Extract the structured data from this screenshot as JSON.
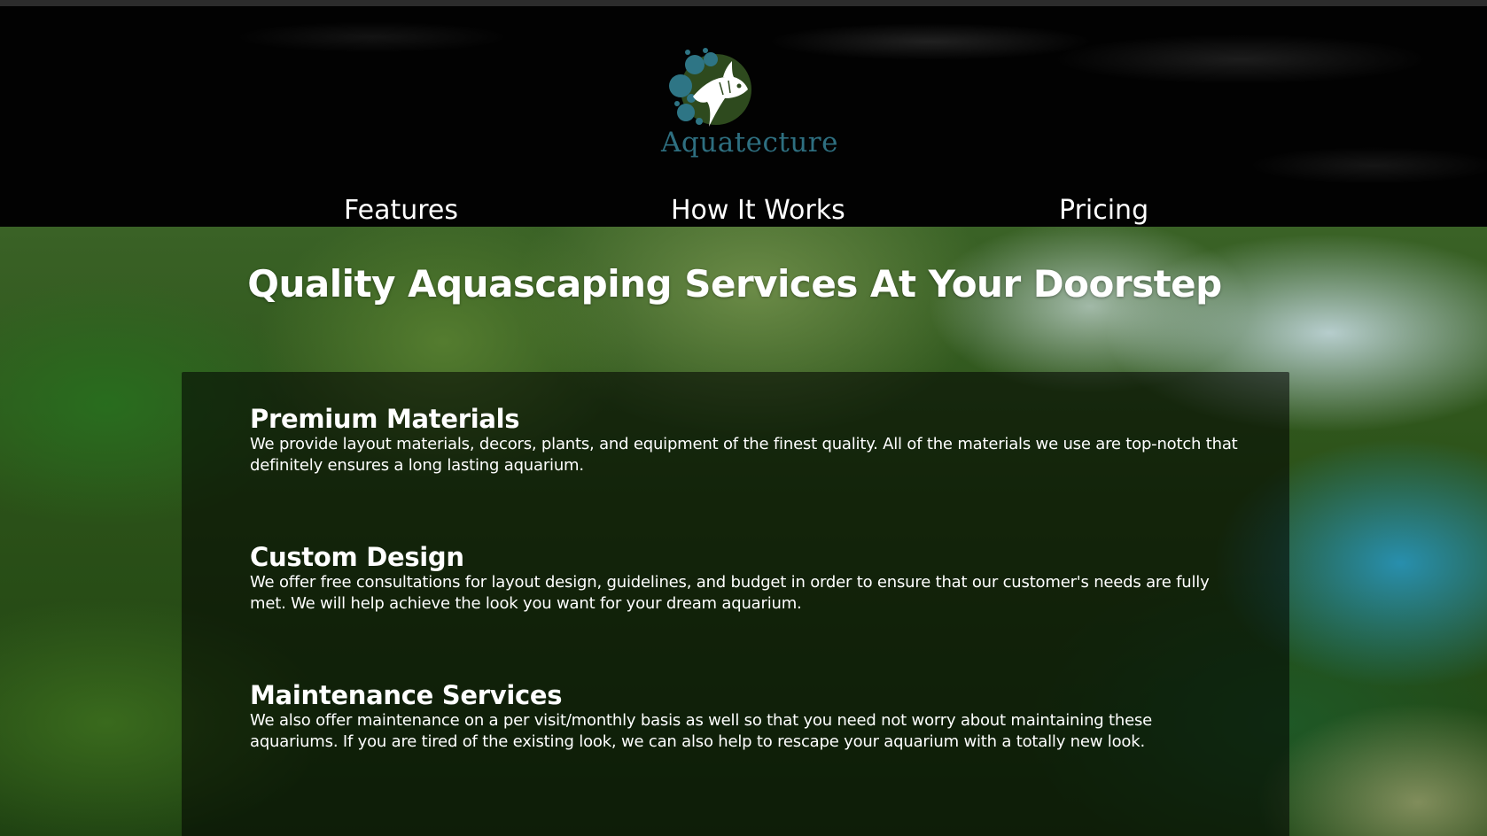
{
  "brand": {
    "name": "Aquatecture",
    "logo_icon": "angelfish-icon",
    "colors": {
      "logo_text": "#2e6f80",
      "logo_bubble": "#2e7585",
      "logo_circle": "#2e4a1e"
    }
  },
  "nav": {
    "items": [
      {
        "label": "Features"
      },
      {
        "label": "How It Works"
      },
      {
        "label": "Pricing"
      }
    ]
  },
  "hero": {
    "title": "Quality Aquascaping Services At Your Doorstep"
  },
  "features": [
    {
      "title": "Premium Materials",
      "description": "We provide layout materials, decors, plants, and equipment of the finest quality. All of the materials we use are top-notch that definitely ensures a long lasting aquarium."
    },
    {
      "title": "Custom Design",
      "description": "We offer free consultations for layout design, guidelines, and budget in order to ensure that our customer's needs are fully met. We will help achieve the look you want for your dream aquarium."
    },
    {
      "title": "Maintenance Services",
      "description": "We also offer maintenance on a per visit/monthly basis as well so that you need not worry about maintaining these aquariums. If you are tired of the existing look, we can also help to rescape your aquarium with a totally new look."
    }
  ]
}
